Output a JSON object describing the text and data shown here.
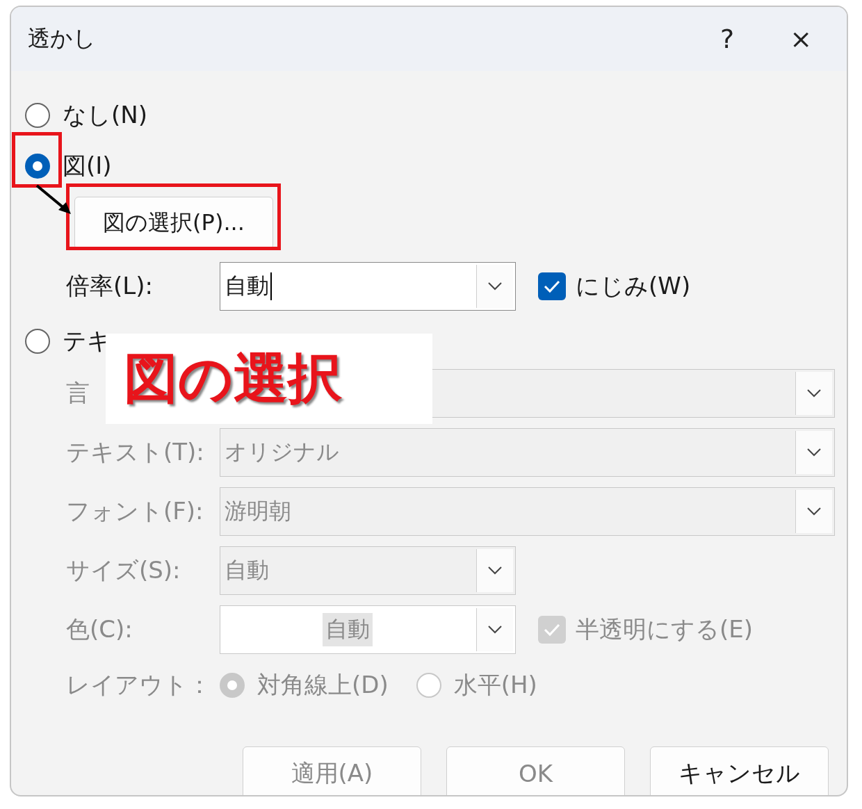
{
  "window": {
    "title": "透かし",
    "help": "?",
    "close": "×"
  },
  "none_option": {
    "label": "なし(N)",
    "selected": false
  },
  "picture_option": {
    "label": "図(I)",
    "selected": true,
    "select_button": "図の選択(P)...",
    "scale": {
      "label": "倍率(L):",
      "value": "自動"
    },
    "washout": {
      "label": "にじみ(W)",
      "checked": true
    }
  },
  "text_option": {
    "label": "テキ",
    "selected": false,
    "fields": [
      {
        "kind": "covered",
        "label": "言",
        "disabled": true
      },
      {
        "kind": "wide",
        "label": "テキスト(T):",
        "value": "オリジナル",
        "disabled": true
      },
      {
        "kind": "wide",
        "label": "フォント(F):",
        "value": "游明朝",
        "disabled": true
      },
      {
        "kind": "narrow",
        "label": "サイズ(S):",
        "value": "自動",
        "disabled": true
      },
      {
        "kind": "color",
        "label": "色(C):",
        "value": "自動",
        "disabled": true,
        "semitransparent": {
          "label": "半透明にする(E)",
          "checked": true,
          "disabled": true
        }
      }
    ],
    "layout": {
      "label": "レイアウト：",
      "disabled": true,
      "options": [
        {
          "label": "対角線上(D)",
          "selected": true
        },
        {
          "label": "水平(H)",
          "selected": false
        }
      ]
    }
  },
  "buttons": [
    {
      "label": "適用(A)",
      "disabled": true
    },
    {
      "label": "OK",
      "disabled": true
    },
    {
      "label": "キャンセル",
      "disabled": false
    }
  ],
  "annotation": {
    "callout": "図の選択"
  }
}
